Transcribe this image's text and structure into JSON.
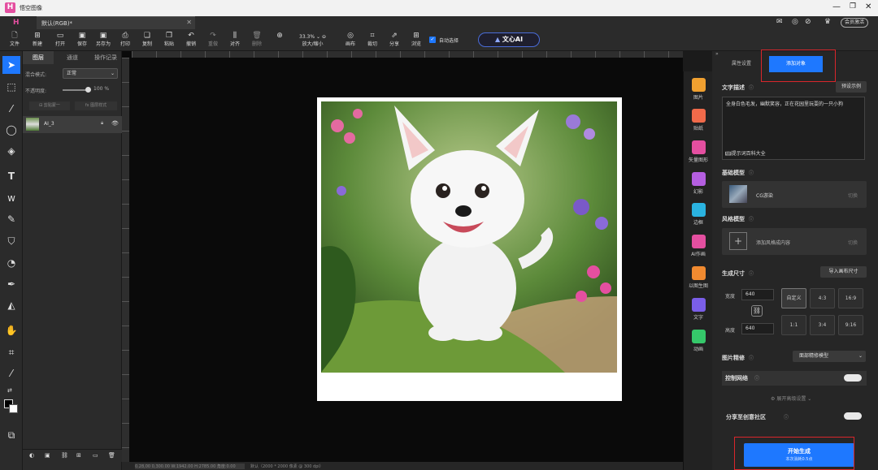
{
  "app": {
    "title": "悟空图像",
    "doc_tab": "默认(RGB)*",
    "member_label": "会员激活"
  },
  "toolbar": {
    "items": [
      {
        "name": "file",
        "label": "文件",
        "icon": "file-icon"
      },
      {
        "name": "new",
        "label": "新建",
        "icon": "new-icon"
      },
      {
        "name": "open",
        "label": "打开",
        "icon": "open-icon"
      },
      {
        "name": "save",
        "label": "保存",
        "icon": "save-icon"
      },
      {
        "name": "save-as",
        "label": "另存为",
        "icon": "save-as-icon"
      },
      {
        "name": "print",
        "label": "打印",
        "icon": "print-icon"
      },
      {
        "name": "copy",
        "label": "复制",
        "icon": "copy-icon"
      },
      {
        "name": "paste",
        "label": "粘贴",
        "icon": "paste-icon"
      },
      {
        "name": "undo",
        "label": "撤销",
        "icon": "undo-icon"
      },
      {
        "name": "redo",
        "label": "重做",
        "icon": "redo-icon"
      },
      {
        "name": "align",
        "label": "对齐",
        "icon": "align-icon"
      },
      {
        "name": "delete",
        "label": "删除",
        "icon": "delete-icon"
      }
    ],
    "zoom_value": "33.3%",
    "zoom_label": "放大/缩小",
    "canvas_label": "画布",
    "crop_label": "裁切",
    "share_label": "分享",
    "browse_label": "浏览",
    "auto_select_label": "自动选择",
    "ai_label": "文心AI"
  },
  "layers": {
    "tabs": [
      "图层",
      "通道",
      "操作记录"
    ],
    "blend_label": "混合模式:",
    "blend_value": "正常",
    "opacity_label": "不透明度:",
    "opacity_value": "100",
    "opacity_unit": "%",
    "opacity_fraction": 1.0,
    "clip_label": "剪贴蒙一",
    "style_label": "图层样式",
    "layer_name": "AI_3"
  },
  "statusbar": {
    "left": "0.28,00 0,300.00 W:1942.00 H:2785.00 角度:0.00",
    "middle": "默认（2000 * 2000 像素 @ 300 dpi）"
  },
  "icon_strip": {
    "items": [
      {
        "label": "图片",
        "color": "#f0a030"
      },
      {
        "label": "贴纸",
        "color": "#f06a4a"
      },
      {
        "label": "矢量图形",
        "color": "#e44fa0"
      },
      {
        "label": "幻影",
        "color": "#b45ee0"
      },
      {
        "label": "边框",
        "color": "#2ab3e0"
      },
      {
        "label": "AI作画",
        "color": "#e44fa0"
      },
      {
        "label": "以图生图",
        "color": "#f08a30"
      },
      {
        "label": "文字",
        "color": "#7a5ee8"
      },
      {
        "label": "动画",
        "color": "#35c86a"
      }
    ]
  },
  "right_panel": {
    "tabs": [
      "属性设置",
      "添加对象"
    ],
    "text_desc_label": "文字描述",
    "preset_button": "预设示例",
    "prompt_text": "全身白色毛发，幽默笑容，正在花园里玩耍的一只小狗",
    "prompt_tip": "提示词百科大全",
    "base_model_label": "基础模型",
    "base_model_value": "CG游染",
    "switch_label": "切换",
    "style_model_label": "风格模型",
    "style_model_add": "添加风格成内容",
    "size_label": "生成尺寸",
    "import_size_button": "导入画布尺寸",
    "width_label": "宽度",
    "width_value": "640",
    "height_label": "高度",
    "height_value": "640",
    "ratios": [
      "自定义",
      "4:3",
      "16:9",
      "1:1",
      "3:4",
      "9:16"
    ],
    "refine_label": "图片精修",
    "refine_value": "面部精修模型",
    "control_net_label": "控制网络",
    "advanced_label": "展开高级设置",
    "share_label": "分享至创意社区",
    "generate_label": "开始生成",
    "generate_sub": "本次消耗0.5点"
  },
  "colors": {
    "accent": "#1e78ff",
    "highlight": "#d9262b"
  }
}
